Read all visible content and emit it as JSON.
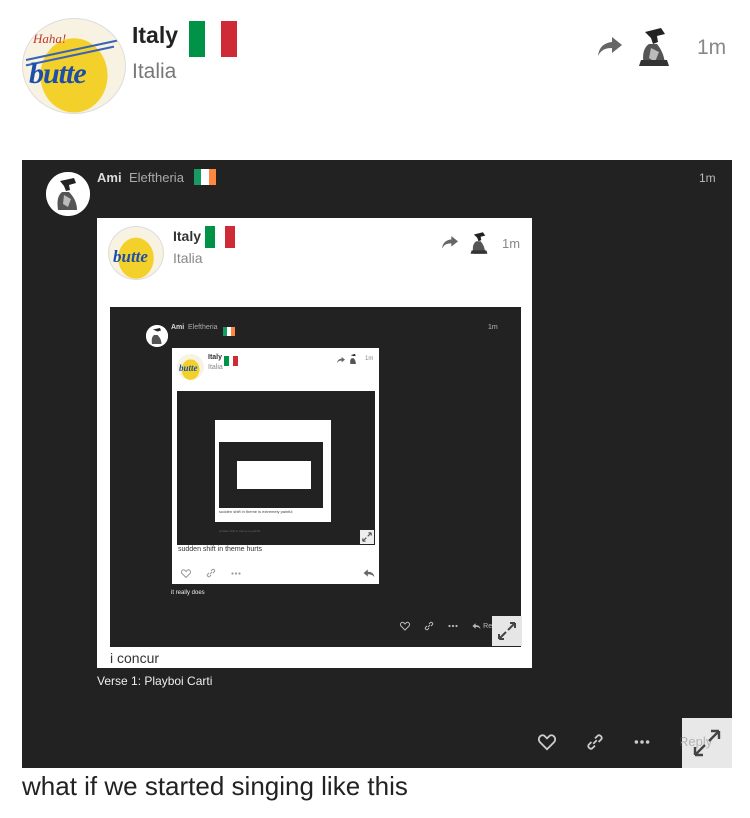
{
  "post": {
    "title": "Italy",
    "subtitle": "Italia",
    "time": "1m",
    "caption": "what if we started singing like this"
  },
  "embed": {
    "name": "Ami",
    "username": "Eleftheria",
    "time": "1m",
    "verse": "Verse 1: Playboi Carti",
    "inner": {
      "title": "Italy",
      "subtitle": "Italia",
      "time": "1m",
      "caption": "i concur",
      "embed": {
        "name": "Ami",
        "username": "Eleftheria",
        "time": "1m",
        "caption": "it really does",
        "reply_label": "Rep",
        "inner": {
          "title": "Italy",
          "subtitle": "Italia",
          "time": "1m",
          "caption": "sudden shift in theme hurts",
          "nested_caption_a": "sudden shift in theme is extremely painful",
          "nested_caption_b": "sudden shift in theme is painful"
        }
      }
    },
    "reply_label": "Reply"
  },
  "avatar_text": {
    "haha": "Haha!",
    "butte": "butte"
  },
  "colors": {
    "italy_green": "#009246",
    "italy_white": "#ffffff",
    "italy_red": "#ce2b37",
    "ireland_green": "#169b62",
    "ireland_orange": "#ff883e",
    "dark_bg": "#222222"
  }
}
